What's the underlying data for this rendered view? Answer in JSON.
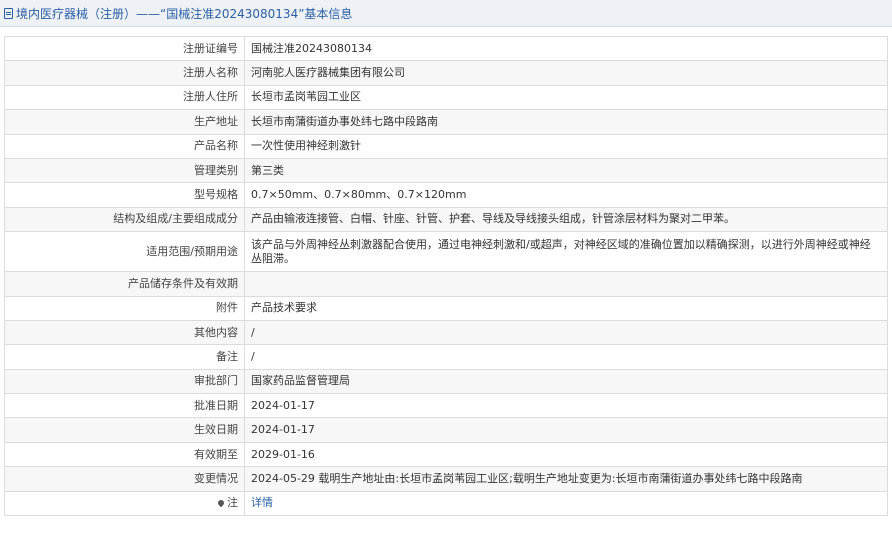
{
  "header": {
    "icon": "document-icon",
    "title": "境内医疗器械（注册）——“国械注准20243080134”基本信息"
  },
  "rows": [
    {
      "label": "注册证编号",
      "value": "国械注准20243080134"
    },
    {
      "label": "注册人名称",
      "value": "河南驼人医疗器械集团有限公司"
    },
    {
      "label": "注册人住所",
      "value": "长垣市孟岗苇园工业区"
    },
    {
      "label": "生产地址",
      "value": "长垣市南蒲街道办事处纬七路中段路南"
    },
    {
      "label": "产品名称",
      "value": "一次性使用神经刺激针"
    },
    {
      "label": "管理类别",
      "value": "第三类"
    },
    {
      "label": "型号规格",
      "value": "0.7×50mm、0.7×80mm、0.7×120mm"
    },
    {
      "label": "结构及组成/主要组成成分",
      "value": "产品由输液连接管、白帽、针座、针管、护套、导线及导线接头组成，针管涂层材料为聚对二甲苯。"
    },
    {
      "label": "适用范围/预期用途",
      "value": "该产品与外周神经丛刺激器配合使用，通过电神经刺激和/或超声，对神经区域的准确位置加以精确探测，以进行外周神经或神经丛阻滞。"
    },
    {
      "label": "产品储存条件及有效期",
      "value": ""
    },
    {
      "label": "附件",
      "value": "产品技术要求"
    },
    {
      "label": "其他内容",
      "value": "/"
    },
    {
      "label": "备注",
      "value": "/"
    },
    {
      "label": "审批部门",
      "value": "国家药品监督管理局"
    },
    {
      "label": "批准日期",
      "value": "2024-01-17"
    },
    {
      "label": "生效日期",
      "value": "2024-01-17"
    },
    {
      "label": "有效期至",
      "value": "2029-01-16"
    },
    {
      "label": "变更情况",
      "value": "2024-05-29 载明生产地址由:长垣市孟岗苇园工业区;载明生产地址变更为:长垣市南蒲街道办事处纬七路中段路南"
    }
  ],
  "note_row": {
    "label": "注",
    "icon": "pin-icon",
    "link": "详情"
  }
}
